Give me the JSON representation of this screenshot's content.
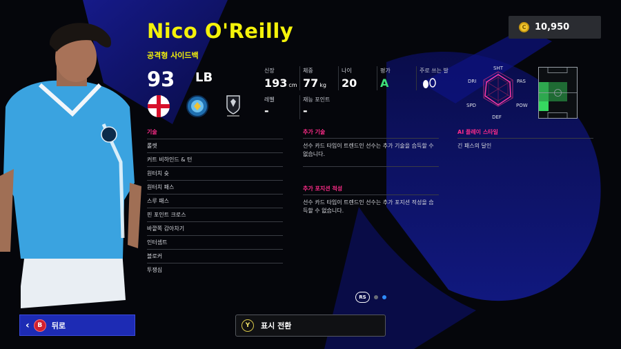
{
  "player": {
    "name": "Nico O'Reilly",
    "position_type": "공격형 사이드백",
    "rating": "93",
    "position_code": "LB"
  },
  "coins": {
    "amount": "10,950"
  },
  "stats": {
    "height_label": "신장",
    "height_value": "193",
    "height_unit": "cm",
    "weight_label": "체중",
    "weight_value": "77",
    "weight_unit": "kg",
    "age_label": "나이",
    "age_value": "20",
    "eval_label": "평가",
    "eval_value": "A",
    "foot_label": "주로 쓰는 발",
    "level_label": "레벨",
    "level_value": "-",
    "talent_label": "재능 포인트",
    "talent_value": "-"
  },
  "radar": {
    "labels": [
      "SHT",
      "PAS",
      "POW",
      "DEF",
      "SPD",
      "DRI"
    ]
  },
  "skills": {
    "title": "기술",
    "items": [
      "롤렛",
      "커트 비하인드 & 턴",
      "원터치 슛",
      "원터치 패스",
      "스루 패스",
      "핀 포인트 크로스",
      "바깥쪽 감아차기",
      "인터셉트",
      "블로커",
      "투쟁심"
    ]
  },
  "additional_skills": {
    "title": "추가 기술",
    "text": "선수 카드 타입이 트렌드인 선수는 추가 기술을 습득할 수 없습니다."
  },
  "additional_positions": {
    "title": "추가 포지션 적성",
    "text": "선수 카드 타입이 트렌드인 선수는 추가 포지션 적성을 습득할 수 없습니다."
  },
  "ai_style": {
    "title": "AI 플레이 스타일",
    "items": [
      "긴 패스의 달인"
    ]
  },
  "pager": {
    "label": "RS"
  },
  "buttons": {
    "back_key": "B",
    "back_label": "뒤로",
    "switch_key": "Y",
    "switch_label": "표시 전환"
  },
  "colors": {
    "accent_yellow": "#f4f20a",
    "accent_pink": "#ff2c89",
    "back_button": "#1d2bb4"
  }
}
